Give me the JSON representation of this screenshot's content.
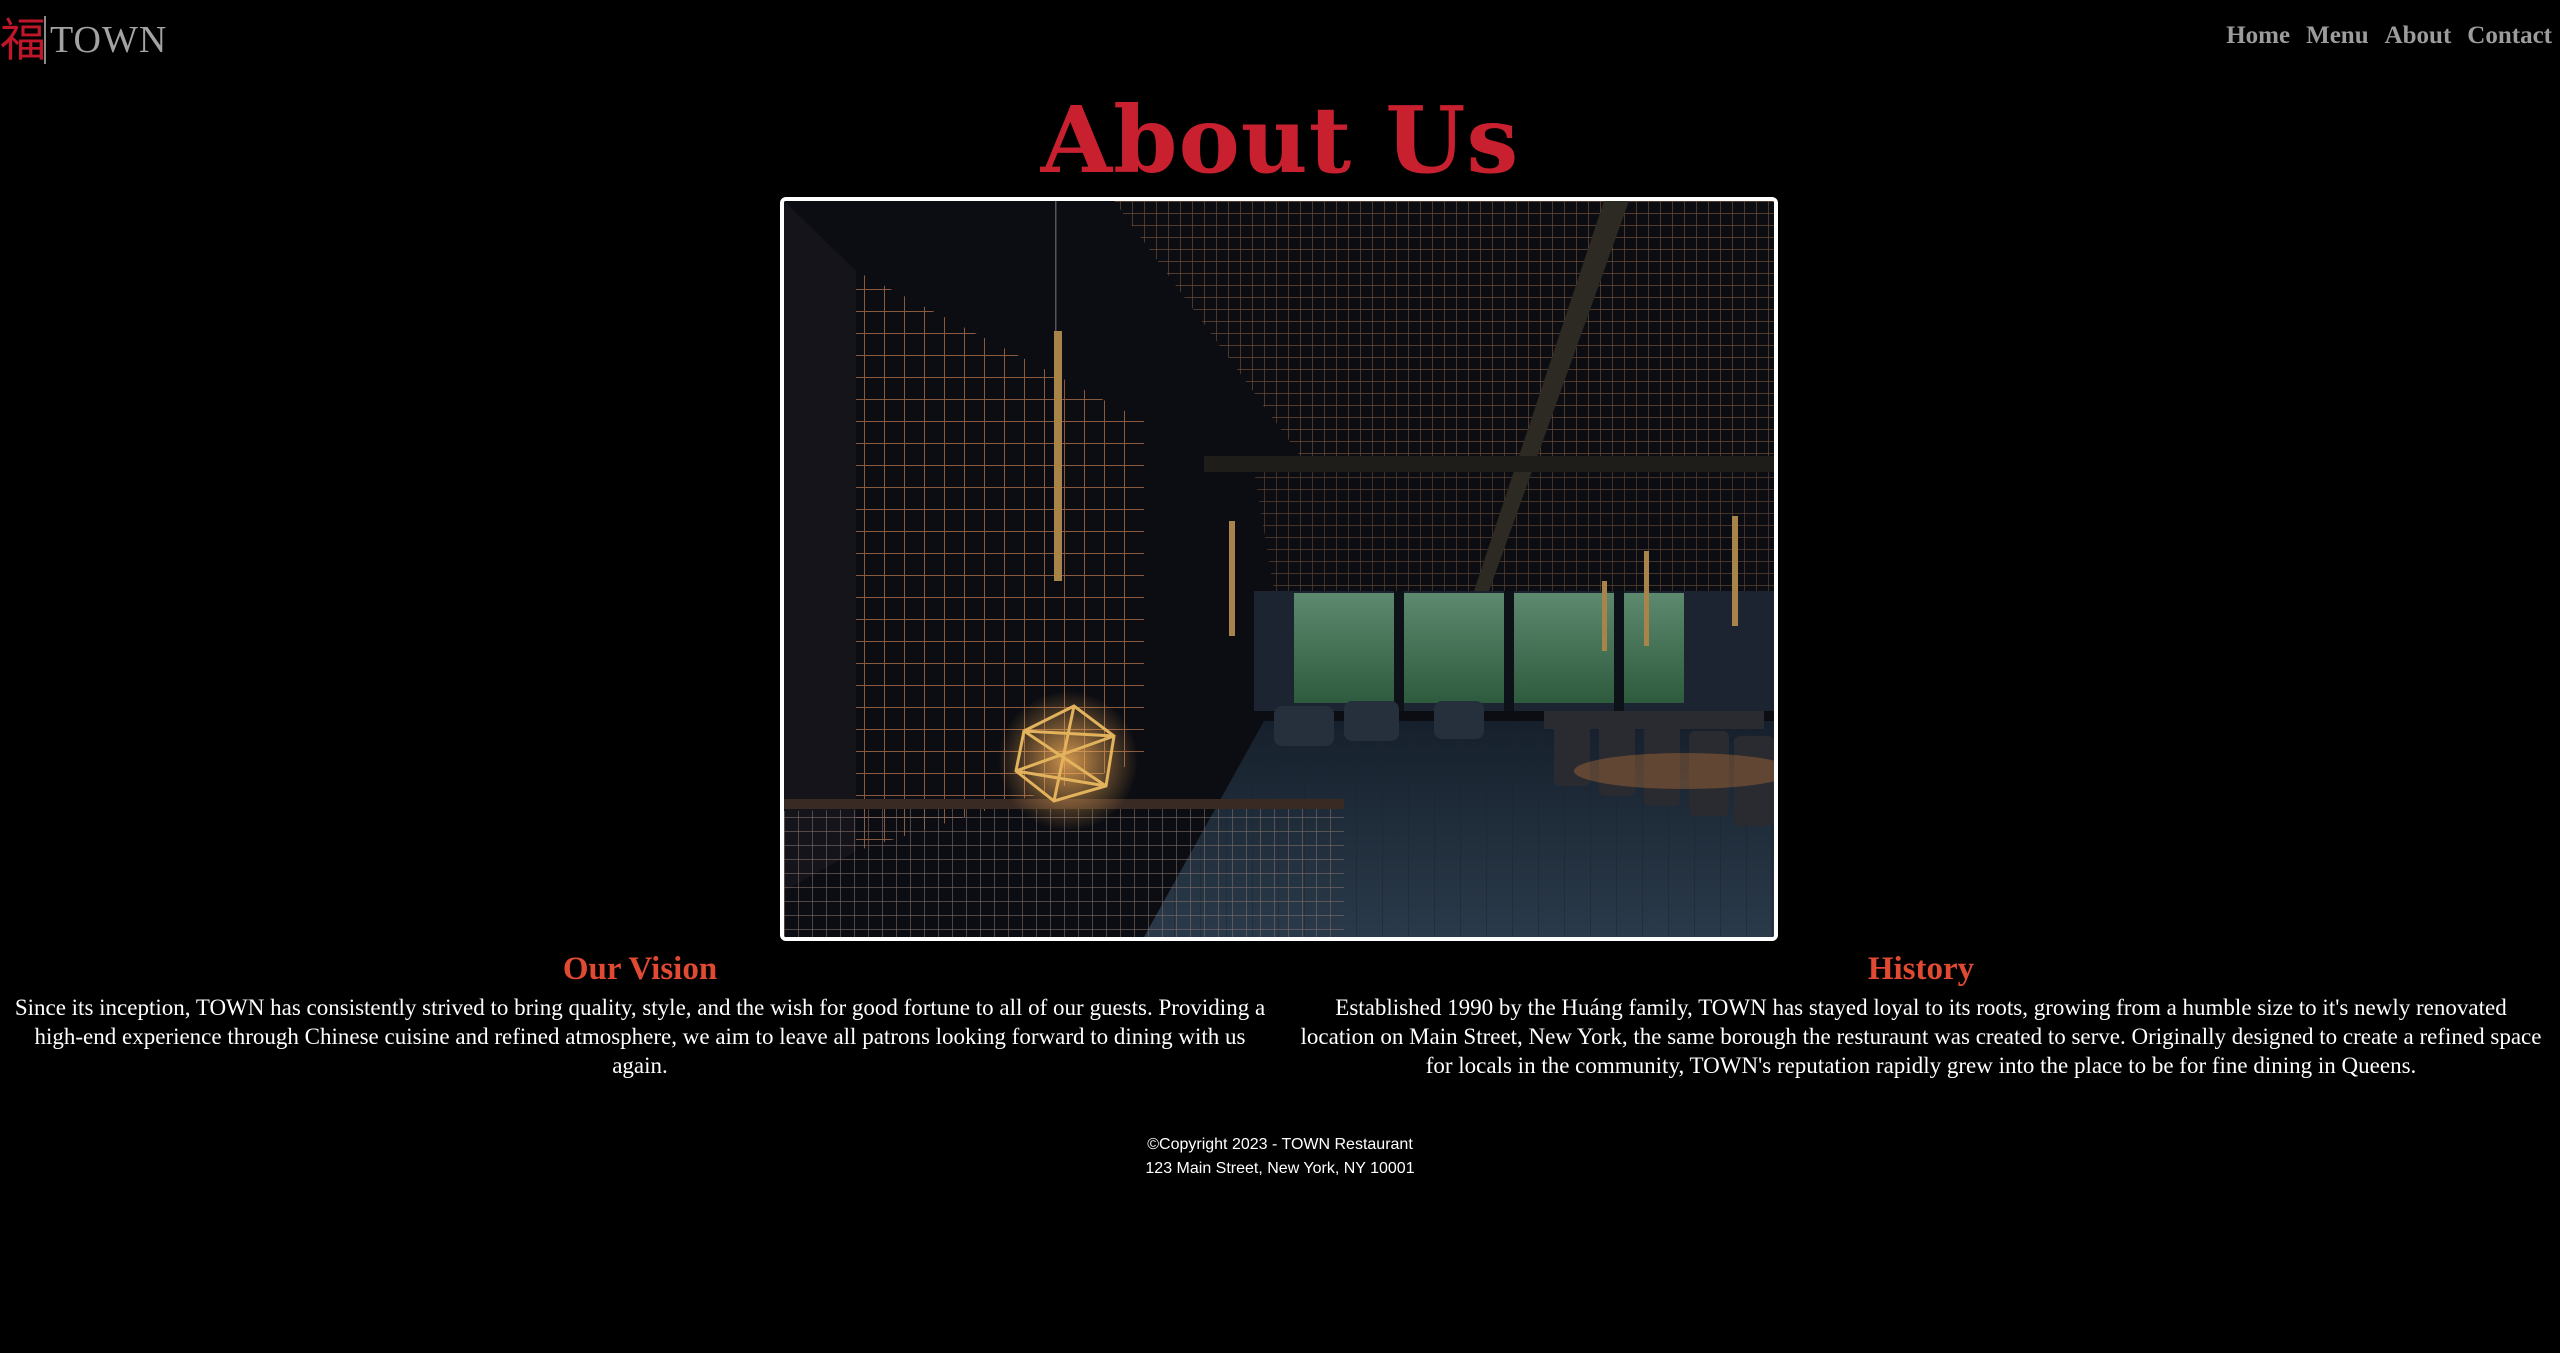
{
  "brand": {
    "mark": "福",
    "name": "TOWN",
    "accent_color": "#c8202f"
  },
  "nav": {
    "items": [
      {
        "label": "Home"
      },
      {
        "label": "Menu"
      },
      {
        "label": "About"
      },
      {
        "label": "Contact"
      }
    ]
  },
  "page": {
    "title": "About Us"
  },
  "hero_image": {
    "description_icon": "restaurant-interior-photo"
  },
  "sections": {
    "vision": {
      "heading": "Our Vision",
      "body": "Since its inception, TOWN has consistently strived to bring quality, style, and the wish for good fortune to all of our guests. Providing a high-end experience through Chinese cuisine and refined atmosphere, we aim to leave all patrons looking forward to dining with us again."
    },
    "history": {
      "heading": "History",
      "body": "Established 1990 by the Huáng family, TOWN has stayed loyal to its roots, growing from a humble size to it's newly renovated location on Main Street, New York, the same borough the resturaunt was created to serve. Originally designed to create a refined space for locals in the community, TOWN's reputation rapidly grew into the place to be for fine dining in Queens."
    }
  },
  "footer": {
    "copyright": "©Copyright 2023 - TOWN Restaurant",
    "address": "123 Main Street, New York, NY 10001"
  }
}
